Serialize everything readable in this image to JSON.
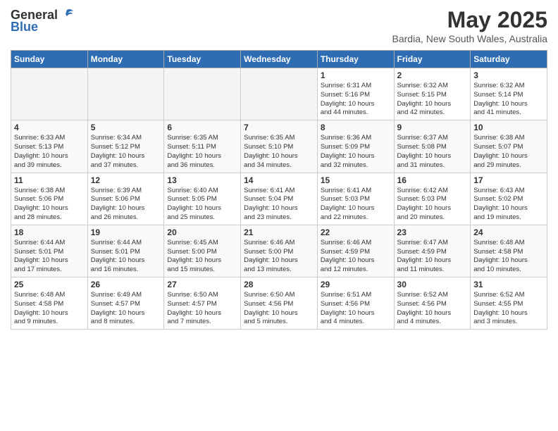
{
  "header": {
    "logo_general": "General",
    "logo_blue": "Blue",
    "title": "May 2025",
    "subtitle": "Bardia, New South Wales, Australia"
  },
  "days_of_week": [
    "Sunday",
    "Monday",
    "Tuesday",
    "Wednesday",
    "Thursday",
    "Friday",
    "Saturday"
  ],
  "weeks": [
    [
      {
        "day": "",
        "info": ""
      },
      {
        "day": "",
        "info": ""
      },
      {
        "day": "",
        "info": ""
      },
      {
        "day": "",
        "info": ""
      },
      {
        "day": "1",
        "info": "Sunrise: 6:31 AM\nSunset: 5:16 PM\nDaylight: 10 hours\nand 44 minutes."
      },
      {
        "day": "2",
        "info": "Sunrise: 6:32 AM\nSunset: 5:15 PM\nDaylight: 10 hours\nand 42 minutes."
      },
      {
        "day": "3",
        "info": "Sunrise: 6:32 AM\nSunset: 5:14 PM\nDaylight: 10 hours\nand 41 minutes."
      }
    ],
    [
      {
        "day": "4",
        "info": "Sunrise: 6:33 AM\nSunset: 5:13 PM\nDaylight: 10 hours\nand 39 minutes."
      },
      {
        "day": "5",
        "info": "Sunrise: 6:34 AM\nSunset: 5:12 PM\nDaylight: 10 hours\nand 37 minutes."
      },
      {
        "day": "6",
        "info": "Sunrise: 6:35 AM\nSunset: 5:11 PM\nDaylight: 10 hours\nand 36 minutes."
      },
      {
        "day": "7",
        "info": "Sunrise: 6:35 AM\nSunset: 5:10 PM\nDaylight: 10 hours\nand 34 minutes."
      },
      {
        "day": "8",
        "info": "Sunrise: 6:36 AM\nSunset: 5:09 PM\nDaylight: 10 hours\nand 32 minutes."
      },
      {
        "day": "9",
        "info": "Sunrise: 6:37 AM\nSunset: 5:08 PM\nDaylight: 10 hours\nand 31 minutes."
      },
      {
        "day": "10",
        "info": "Sunrise: 6:38 AM\nSunset: 5:07 PM\nDaylight: 10 hours\nand 29 minutes."
      }
    ],
    [
      {
        "day": "11",
        "info": "Sunrise: 6:38 AM\nSunset: 5:06 PM\nDaylight: 10 hours\nand 28 minutes."
      },
      {
        "day": "12",
        "info": "Sunrise: 6:39 AM\nSunset: 5:06 PM\nDaylight: 10 hours\nand 26 minutes."
      },
      {
        "day": "13",
        "info": "Sunrise: 6:40 AM\nSunset: 5:05 PM\nDaylight: 10 hours\nand 25 minutes."
      },
      {
        "day": "14",
        "info": "Sunrise: 6:41 AM\nSunset: 5:04 PM\nDaylight: 10 hours\nand 23 minutes."
      },
      {
        "day": "15",
        "info": "Sunrise: 6:41 AM\nSunset: 5:03 PM\nDaylight: 10 hours\nand 22 minutes."
      },
      {
        "day": "16",
        "info": "Sunrise: 6:42 AM\nSunset: 5:03 PM\nDaylight: 10 hours\nand 20 minutes."
      },
      {
        "day": "17",
        "info": "Sunrise: 6:43 AM\nSunset: 5:02 PM\nDaylight: 10 hours\nand 19 minutes."
      }
    ],
    [
      {
        "day": "18",
        "info": "Sunrise: 6:44 AM\nSunset: 5:01 PM\nDaylight: 10 hours\nand 17 minutes."
      },
      {
        "day": "19",
        "info": "Sunrise: 6:44 AM\nSunset: 5:01 PM\nDaylight: 10 hours\nand 16 minutes."
      },
      {
        "day": "20",
        "info": "Sunrise: 6:45 AM\nSunset: 5:00 PM\nDaylight: 10 hours\nand 15 minutes."
      },
      {
        "day": "21",
        "info": "Sunrise: 6:46 AM\nSunset: 5:00 PM\nDaylight: 10 hours\nand 13 minutes."
      },
      {
        "day": "22",
        "info": "Sunrise: 6:46 AM\nSunset: 4:59 PM\nDaylight: 10 hours\nand 12 minutes."
      },
      {
        "day": "23",
        "info": "Sunrise: 6:47 AM\nSunset: 4:59 PM\nDaylight: 10 hours\nand 11 minutes."
      },
      {
        "day": "24",
        "info": "Sunrise: 6:48 AM\nSunset: 4:58 PM\nDaylight: 10 hours\nand 10 minutes."
      }
    ],
    [
      {
        "day": "25",
        "info": "Sunrise: 6:48 AM\nSunset: 4:58 PM\nDaylight: 10 hours\nand 9 minutes."
      },
      {
        "day": "26",
        "info": "Sunrise: 6:49 AM\nSunset: 4:57 PM\nDaylight: 10 hours\nand 8 minutes."
      },
      {
        "day": "27",
        "info": "Sunrise: 6:50 AM\nSunset: 4:57 PM\nDaylight: 10 hours\nand 7 minutes."
      },
      {
        "day": "28",
        "info": "Sunrise: 6:50 AM\nSunset: 4:56 PM\nDaylight: 10 hours\nand 5 minutes."
      },
      {
        "day": "29",
        "info": "Sunrise: 6:51 AM\nSunset: 4:56 PM\nDaylight: 10 hours\nand 4 minutes."
      },
      {
        "day": "30",
        "info": "Sunrise: 6:52 AM\nSunset: 4:56 PM\nDaylight: 10 hours\nand 4 minutes."
      },
      {
        "day": "31",
        "info": "Sunrise: 6:52 AM\nSunset: 4:55 PM\nDaylight: 10 hours\nand 3 minutes."
      }
    ]
  ]
}
